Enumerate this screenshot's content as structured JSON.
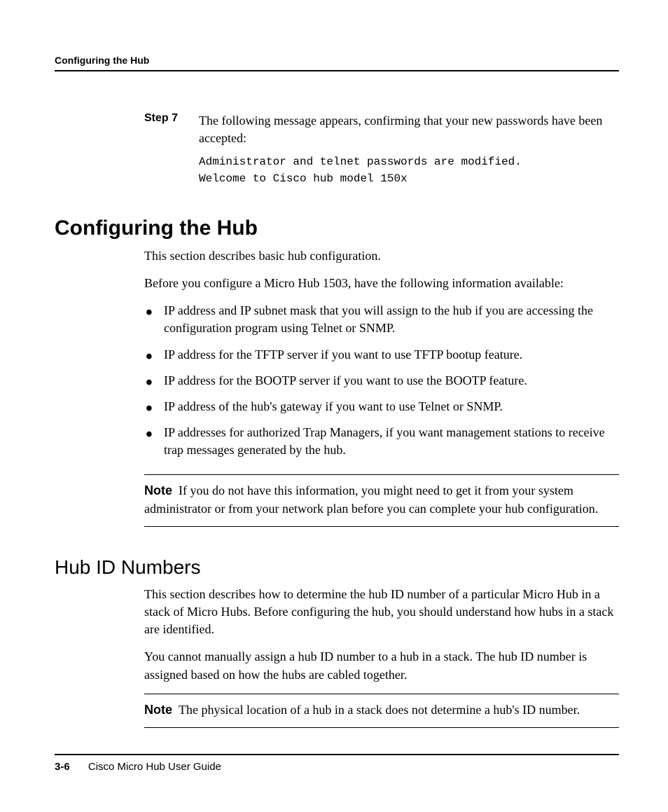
{
  "header": {
    "running": "Configuring the Hub"
  },
  "step7": {
    "label": "Step 7",
    "text": "The following message appears, confirming that your new passwords have been accepted:",
    "code_line1": "Administrator and telnet passwords are modified.",
    "code_line2": "Welcome to Cisco hub model 150x"
  },
  "section": {
    "heading": "Configuring the Hub",
    "p1": "This section describes basic hub configuration.",
    "p2": "Before you configure a Micro Hub 1503, have the following information available:",
    "bullets": {
      "b1": "IP address and IP subnet mask that you will assign to the hub if you are accessing the configuration program using Telnet or SNMP.",
      "b2": "IP address for the TFTP server if you want to use TFTP bootup feature.",
      "b3": "IP address for the BOOTP server if you want to use the BOOTP feature.",
      "b4": "IP address of the hub's gateway if you want to use Telnet or SNMP.",
      "b5": "IP addresses for authorized Trap Managers, if you want management stations to receive trap messages generated by the hub."
    },
    "note": {
      "label": "Note",
      "text": "If you do not have this information, you might need to get it from your system administrator or from your network plan before you can complete your hub configuration."
    }
  },
  "subsection": {
    "heading": "Hub ID Numbers",
    "p1": "This section describes how to determine the hub ID number of a particular Micro Hub in a stack of Micro Hubs. Before configuring the hub, you should understand how hubs in a stack are identified.",
    "p2": "You cannot manually assign a hub ID number to a hub in a stack. The hub ID number is assigned based on how the hubs are cabled together.",
    "note": {
      "label": "Note",
      "text": "The physical location of a hub in a stack does not determine a hub's ID number."
    }
  },
  "footer": {
    "page": "3-6",
    "guide": "Cisco Micro Hub User Guide"
  }
}
